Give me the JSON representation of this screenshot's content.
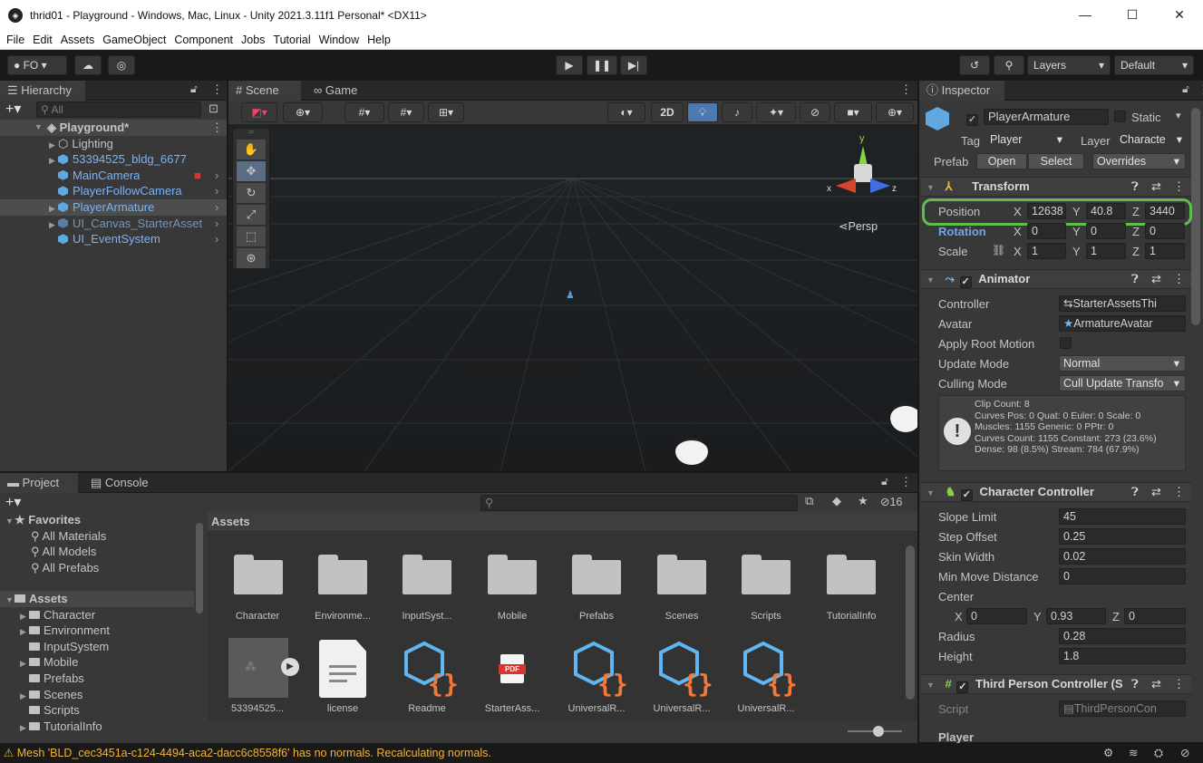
{
  "window": {
    "title": "thrid01 - Playground - Windows, Mac, Linux - Unity 2021.3.11f1 Personal* <DX11>",
    "controls": [
      "—",
      "☐",
      "✕"
    ]
  },
  "menu": [
    "File",
    "Edit",
    "Assets",
    "GameObject",
    "Component",
    "Jobs",
    "Tutorial",
    "Window",
    "Help"
  ],
  "toolbar": {
    "account": "FO",
    "layers": "Layers",
    "layout": "Default"
  },
  "hierarchy": {
    "tab": "Hierarchy",
    "search_placeholder": "All",
    "scene": "Playground*",
    "items": [
      {
        "label": "Lighting",
        "style": "normal"
      },
      {
        "label": "53394525_bldg_6677",
        "style": "blue"
      },
      {
        "label": "MainCamera",
        "style": "blue"
      },
      {
        "label": "PlayerFollowCamera",
        "style": "blue"
      },
      {
        "label": "PlayerArmature",
        "style": "blue"
      },
      {
        "label": "UI_Canvas_StarterAsset",
        "style": "greyblue"
      },
      {
        "label": "UI_EventSystem",
        "style": "blue"
      }
    ]
  },
  "scene": {
    "tabs": [
      "Scene",
      "Game"
    ],
    "btn_2d": "2D",
    "persp": "Persp",
    "gizmo_y": "y",
    "gizmo_x": "x",
    "gizmo_z": "z"
  },
  "inspector": {
    "tab": "Inspector",
    "object_name": "PlayerArmature",
    "static_label": "Static",
    "tag_label": "Tag",
    "tag_value": "Player",
    "layer_label": "Layer",
    "layer_value": "Characte",
    "prefab_label": "Prefab",
    "prefab_open": "Open",
    "prefab_select": "Select",
    "prefab_overrides": "Overrides",
    "transform": {
      "title": "Transform",
      "position_label": "Position",
      "rotation_label": "Rotation",
      "scale_label": "Scale",
      "position": {
        "x": "12638",
        "y": "40.8",
        "z": "3440"
      },
      "rotation": {
        "x": "0",
        "y": "0",
        "z": "0"
      },
      "scale": {
        "x": "1",
        "y": "1",
        "z": "1"
      },
      "axis_x": "X",
      "axis_y": "Y",
      "axis_z": "Z"
    },
    "animator": {
      "title": "Animator",
      "controller_label": "Controller",
      "controller_value": "StarterAssetsThi",
      "avatar_label": "Avatar",
      "avatar_value": "ArmatureAvatar",
      "apply_root_label": "Apply Root Motion",
      "update_mode_label": "Update Mode",
      "update_mode_value": "Normal",
      "culling_mode_label": "Culling Mode",
      "culling_mode_value": "Cull Update Transfo",
      "info": [
        "Clip Count: 8",
        "Curves Pos: 0 Quat: 0 Euler: 0 Scale: 0",
        "Muscles: 1155 Generic: 0 PPtr: 0",
        "Curves Count: 1155 Constant: 273 (23.6%)",
        "Dense: 98 (8.5%) Stream: 784 (67.9%)"
      ]
    },
    "character_controller": {
      "title": "Character Controller",
      "rows": [
        {
          "label": "Slope Limit",
          "value": "45"
        },
        {
          "label": "Step Offset",
          "value": "0.25"
        },
        {
          "label": "Skin Width",
          "value": "0.02"
        },
        {
          "label": "Min Move Distance",
          "value": "0"
        }
      ],
      "center_label": "Center",
      "center": {
        "x": "0",
        "y": "0.93",
        "z": "0"
      },
      "radius_label": "Radius",
      "radius_value": "0.28",
      "height_label": "Height",
      "height_value": "1.8"
    },
    "third_person": {
      "title": "Third Person Controller (S",
      "script_label": "Script",
      "script_value": "ThirdPersonCon",
      "player_label": "Player"
    }
  },
  "project": {
    "tabs": [
      "Project",
      "Console"
    ],
    "hidden_count": "16",
    "favorites_label": "Favorites",
    "favorites": [
      "All Materials",
      "All Models",
      "All Prefabs"
    ],
    "assets_label": "Assets",
    "tree": [
      {
        "label": "Character",
        "arrow": true
      },
      {
        "label": "Environment",
        "arrow": true
      },
      {
        "label": "InputSystem",
        "arrow": false
      },
      {
        "label": "Mobile",
        "arrow": true
      },
      {
        "label": "Prefabs",
        "arrow": false
      },
      {
        "label": "Scenes",
        "arrow": true
      },
      {
        "label": "Scripts",
        "arrow": false
      },
      {
        "label": "TutorialInfo",
        "arrow": true
      }
    ],
    "breadcrumb": "Assets",
    "folders": [
      "Character",
      "Environme...",
      "InputSyst...",
      "Mobile",
      "Prefabs",
      "Scenes",
      "Scripts",
      "TutorialInfo"
    ],
    "files": [
      {
        "label": "53394525...",
        "kind": "model"
      },
      {
        "label": "license",
        "kind": "text"
      },
      {
        "label": "Readme",
        "kind": "script-asset"
      },
      {
        "label": "StarterAss...",
        "kind": "pdf"
      },
      {
        "label": "UniversalR...",
        "kind": "script-asset"
      },
      {
        "label": "UniversalR...",
        "kind": "script-asset"
      },
      {
        "label": "UniversalR...",
        "kind": "script-asset"
      }
    ],
    "pdf_text": "PDF"
  },
  "status": {
    "message": "Mesh 'BLD_cec3451a-c124-4494-aca2-dacc6c8558f6' has no normals. Recalculating normals."
  },
  "colors": {
    "highlight": "#5ec04b",
    "accent_blue": "#7cb3f5",
    "warning": "#f2b436"
  }
}
